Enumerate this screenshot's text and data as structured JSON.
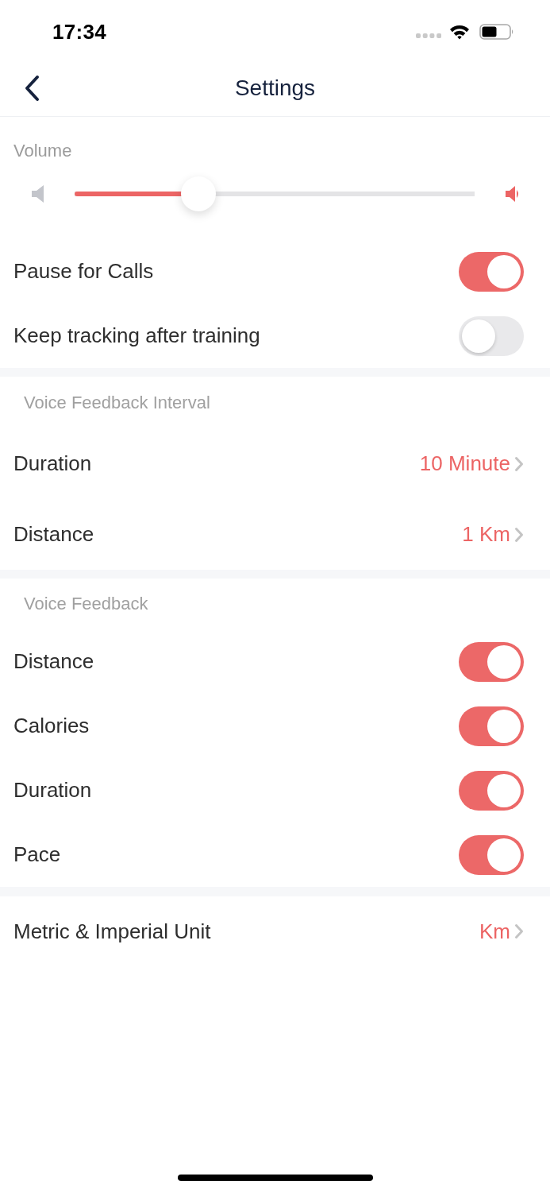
{
  "status_bar": {
    "time": "17:34"
  },
  "nav": {
    "title": "Settings"
  },
  "volume": {
    "label": "Volume",
    "level": 0.31
  },
  "general": [
    {
      "label": "Pause for Calls",
      "on": true
    },
    {
      "label": "Keep tracking after training",
      "on": false
    }
  ],
  "interval": {
    "header": "Voice Feedback Interval",
    "items": [
      {
        "label": "Duration",
        "value": "10 Minute"
      },
      {
        "label": "Distance",
        "value": "1 Km"
      }
    ]
  },
  "voice_feedback": {
    "header": "Voice Feedback",
    "items": [
      {
        "label": "Distance",
        "on": true
      },
      {
        "label": "Calories",
        "on": true
      },
      {
        "label": "Duration",
        "on": true
      },
      {
        "label": "Pace",
        "on": true
      }
    ]
  },
  "units": [
    {
      "label": "Metric & Imperial Unit",
      "value": "Km"
    }
  ]
}
